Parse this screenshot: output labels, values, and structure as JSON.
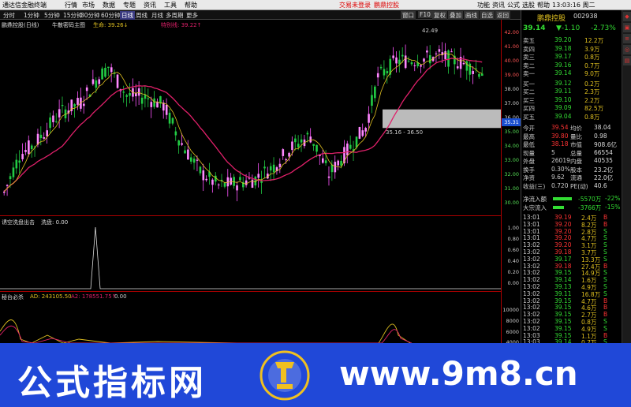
{
  "titlebar": {
    "app": "通达信金融终端",
    "menus": [
      "行情",
      "市场",
      "数据",
      "专题",
      "资讯",
      "工具",
      "帮助"
    ],
    "alerts": [
      "交易未登录",
      "鹏鼎控股"
    ],
    "right_menus": [
      "功能",
      "资讯",
      "公式",
      "选股",
      "帮助"
    ],
    "clock": "13:03:16 周二"
  },
  "toolbar": {
    "periods": [
      "分时",
      "1分钟",
      "5分钟",
      "15分钟",
      "30分钟",
      "60分钟",
      "日线",
      "周线",
      "月线",
      "多周期",
      "更多"
    ],
    "active": "日线",
    "right_tools": [
      "窗口",
      "F10",
      "复权",
      "叠加",
      "画线",
      "自选",
      "返回"
    ]
  },
  "main_panel": {
    "name": "鹏鼎控股(日线)",
    "indicator": "牛散密码主图",
    "life_label": "生命: 39.26↓",
    "dist_label": "特别线: 39.22↑",
    "high_marker": "42.49",
    "zone_label": "35.16 - 36.50",
    "cur_price_tag": "35.31"
  },
  "mid_panel": {
    "title": "诱空洗盘出击",
    "label": "洗盘: 0.00"
  },
  "low_panel": {
    "title": "秘台必杀",
    "ad": "AD: 243105.50",
    "a2": "A2: 178551.75↑",
    "zero": "0.00"
  },
  "axis": {
    "main": [
      "42.00",
      "41.00",
      "40.00",
      "39.00",
      "38.00",
      "37.00",
      "36.00",
      "35.00",
      "34.00",
      "33.00",
      "32.00",
      "31.00",
      "30.00"
    ],
    "mid": [
      "1.00",
      "0.80",
      "0.60",
      "0.40",
      "0.20",
      "0.00"
    ],
    "low": [
      "10000",
      "8000",
      "6000",
      "4000"
    ]
  },
  "quote": {
    "name": "鹏鼎控股",
    "code": "002938",
    "price": "39.14",
    "change": "▼-1.10",
    "pct": "-2.73%",
    "asks": [
      {
        "label": "卖五",
        "p": "39.20",
        "v": "12.2万"
      },
      {
        "label": "卖四",
        "p": "39.18",
        "v": "3.9万"
      },
      {
        "label": "卖三",
        "p": "39.17",
        "v": "0.8万"
      },
      {
        "label": "卖二",
        "p": "39.16",
        "v": "0.7万"
      },
      {
        "label": "卖一",
        "p": "39.14",
        "v": "9.0万"
      }
    ],
    "bids": [
      {
        "label": "买一",
        "p": "39.12",
        "v": "0.2万"
      },
      {
        "label": "买二",
        "p": "39.11",
        "v": "2.3万"
      },
      {
        "label": "买三",
        "p": "39.10",
        "v": "2.2万"
      },
      {
        "label": "买四",
        "p": "39.09",
        "v": "82.5万"
      },
      {
        "label": "买五",
        "p": "39.04",
        "v": "0.8万"
      }
    ],
    "stats": [
      {
        "a": "今开",
        "b": "39.54",
        "c": "均价",
        "d": "38.04"
      },
      {
        "a": "最高",
        "b": "39.80",
        "c": "量比",
        "d": "0.98"
      },
      {
        "a": "最低",
        "b": "38.18",
        "c": "市值",
        "d": "908.6亿"
      },
      {
        "a": "现量",
        "b": "5",
        "c": "总量",
        "d": "66554"
      },
      {
        "a": "外盘",
        "b": "26019",
        "c": "内盘",
        "d": "40535"
      },
      {
        "a": "换手",
        "b": "0.30%",
        "c": "股本",
        "d": "23.2亿"
      },
      {
        "a": "净资",
        "b": "9.62",
        "c": "流通",
        "d": "22.0亿"
      },
      {
        "a": "收益(三)",
        "b": "0.720",
        "c": "PE(动)",
        "d": "40.6"
      }
    ],
    "flows": [
      {
        "label": "净流入额",
        "v": "-5570万",
        "pct": "-22%"
      },
      {
        "label": "大宗流入",
        "v": "-3766万",
        "pct": "-15%"
      }
    ],
    "ticks": [
      {
        "t": "13:01",
        "p": "39.19",
        "v": "2.4万",
        "s": "B"
      },
      {
        "t": "13:01",
        "p": "39.20",
        "v": "8.2万",
        "s": "B"
      },
      {
        "t": "13:01",
        "p": "39.20",
        "v": "2.8万",
        "s": "S"
      },
      {
        "t": "13:01",
        "p": "39.20",
        "v": "4.7万",
        "s": "S"
      },
      {
        "t": "13:02",
        "p": "39.20",
        "v": "3.1万",
        "s": "S"
      },
      {
        "t": "13:02",
        "p": "39.18",
        "v": "3.7万",
        "s": "S"
      },
      {
        "t": "13:02",
        "p": "39.17",
        "v": "13.3万",
        "s": "S"
      },
      {
        "t": "13:02",
        "p": "39.18",
        "v": "27.4万",
        "s": "B"
      },
      {
        "t": "13:02",
        "p": "39.15",
        "v": "14.9万",
        "s": "S"
      },
      {
        "t": "13:02",
        "p": "39.14",
        "v": "1.6万",
        "s": "S"
      },
      {
        "t": "13:02",
        "p": "39.13",
        "v": "4.9万",
        "s": "S"
      },
      {
        "t": "13:02",
        "p": "39.11",
        "v": "16.8万",
        "s": "S"
      },
      {
        "t": "13:02",
        "p": "39.15",
        "v": "4.7万",
        "s": "B"
      },
      {
        "t": "13:02",
        "p": "39.15",
        "v": "4.6万",
        "s": "B"
      },
      {
        "t": "13:02",
        "p": "39.15",
        "v": "2.7万",
        "s": "B"
      },
      {
        "t": "13:02",
        "p": "39.15",
        "v": "0.8万",
        "s": "S"
      },
      {
        "t": "13:02",
        "p": "39.15",
        "v": "4.9万",
        "s": "S"
      },
      {
        "t": "13:03",
        "p": "39.15",
        "v": "1.1万",
        "s": "B"
      },
      {
        "t": "13:03",
        "p": "39.14",
        "v": "0.7万",
        "s": "S"
      }
    ]
  },
  "banner": {
    "cn": "公式指标网",
    "url": "www.9m8.cn",
    "logo_text": "公式指标网 www.9m8.cn"
  },
  "colors": {
    "up": "#ff55ff",
    "down": "#22cc44",
    "ma_red": "#e0206a",
    "ma_yellow": "#e0c020",
    "price_red": "#ff3333",
    "price_green": "#33dd33"
  }
}
